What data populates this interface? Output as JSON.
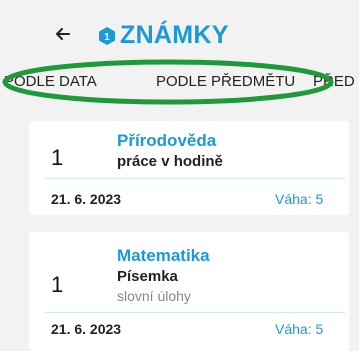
{
  "header": {
    "back_icon": "arrow-left-icon",
    "app_icon": "hexagon-icon",
    "title": "ZNÁMKY"
  },
  "tabs": [
    {
      "label": "PODLE DATA"
    },
    {
      "label": "PODLE PŘEDMĚTU"
    },
    {
      "label": "PŘED"
    }
  ],
  "grades": [
    {
      "grade": "1",
      "subject": "Přírodověda",
      "description": "práce v hodině",
      "note": "",
      "date": "21. 6. 2023",
      "weight": "Váha: 5"
    },
    {
      "grade": "1",
      "subject": "Matematika",
      "description": "Písemka",
      "note": "slovní úlohy",
      "date": "21. 6. 2023",
      "weight": "Váha: 5"
    }
  ],
  "colors": {
    "accent": "#1a9ad6",
    "highlight": "#1f9a3a",
    "background": "#f2f2f2"
  }
}
